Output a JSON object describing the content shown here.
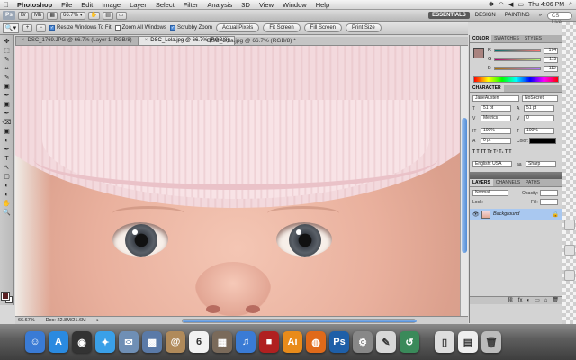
{
  "menubar": {
    "apple": "",
    "items": [
      "Photoshop",
      "File",
      "Edit",
      "Image",
      "Layer",
      "Select",
      "Filter",
      "Analysis",
      "3D",
      "View",
      "Window",
      "Help"
    ],
    "clock": "Thu 4:06 PM"
  },
  "appbar": {
    "logo": "Ps",
    "zoom": "66.7",
    "workspaces": [
      "ESSENTIALS",
      "DESIGN",
      "PAINTING"
    ],
    "more": "»",
    "search_placeholder": "CS Live"
  },
  "options": {
    "resize_windows": "Resize Windows To Fit",
    "zoom_all": "Zoom All Windows",
    "scrubby": "Scrubby Zoom",
    "buttons": [
      "Actual Pixels",
      "Fit Screen",
      "Fill Screen",
      "Print Size"
    ]
  },
  "tools": [
    "▭",
    "✥",
    "⬚",
    "✎",
    "⌗",
    "⌫",
    "✒",
    "🖌",
    "▣",
    "◐",
    "T",
    "↖",
    "▢",
    "✋",
    "🔍",
    "⬛"
  ],
  "doc": {
    "title": "DSC_Lola.jpg @ 66.7% (RGB/8) *",
    "tabs": [
      {
        "label": "DSC_1769.JPG @ 66.7% (Layer 1, RGB/8)",
        "active": false
      },
      {
        "label": "DSC_Lola.jpg @ 66.7% (RGB/8)",
        "active": true
      }
    ],
    "close": "×"
  },
  "status": {
    "zoom": "66.67%",
    "doc": "Doc: 22.8M/21.6M"
  },
  "color_panel": {
    "tabs": [
      "COLOR",
      "SWATCHES",
      "STYLES"
    ],
    "channels": [
      {
        "label": "R",
        "value": "174"
      },
      {
        "label": "G",
        "value": "115"
      },
      {
        "label": "B",
        "value": "113"
      }
    ]
  },
  "character": {
    "tab": "CHARACTER",
    "font": "JaneAusten",
    "style": "NoSecret",
    "size": "51 pt",
    "leading": "51 pt",
    "kerning": "Metrics",
    "tracking": "0",
    "vscale": "100%",
    "hscale": "100%",
    "baseline": "0 pt",
    "color_label": "Color:",
    "language": "English: USA",
    "aa": "Sharp",
    "aa_label": "aa"
  },
  "layers": {
    "tabs": [
      "LAYERS",
      "CHANNELS",
      "PATHS"
    ],
    "blend": "Normal",
    "opacity_label": "Opacity:",
    "lock_label": "Lock:",
    "fill_label": "Fill:",
    "row_name": "Background",
    "footer_icons": [
      "⛓",
      "fx",
      "◐",
      "▭",
      "⌂",
      "🗑"
    ]
  },
  "dock": {
    "icons": [
      {
        "name": "finder",
        "glyph": "☺",
        "color": "#3a7bd5"
      },
      {
        "name": "app-store",
        "glyph": "A",
        "color": "#2a8ae0"
      },
      {
        "name": "dashboard",
        "glyph": "◉",
        "color": "#333"
      },
      {
        "name": "safari",
        "glyph": "✦",
        "color": "#3aa0e8"
      },
      {
        "name": "mail",
        "glyph": "✉",
        "color": "#6f8fb5"
      },
      {
        "name": "iphoto",
        "glyph": "▩",
        "color": "#5a7aa8"
      },
      {
        "name": "address-book",
        "glyph": "@",
        "color": "#b08a5a"
      },
      {
        "name": "ical",
        "glyph": "6",
        "color": "#f2f2f2"
      },
      {
        "name": "preview",
        "glyph": "▦",
        "color": "#7a6a5a"
      },
      {
        "name": "itunes",
        "glyph": "♫",
        "color": "#3a7bd5"
      },
      {
        "name": "photo-booth",
        "glyph": "■",
        "color": "#b02020"
      },
      {
        "name": "illustrator",
        "glyph": "Ai",
        "color": "#e98b1a"
      },
      {
        "name": "firefox",
        "glyph": "◍",
        "color": "#e06a1a"
      },
      {
        "name": "photoshop",
        "glyph": "Ps",
        "color": "#1e5fa8"
      },
      {
        "name": "system-preferences",
        "glyph": "⚙",
        "color": "#888"
      },
      {
        "name": "textedit",
        "glyph": "✎",
        "color": "#d8d8d8"
      },
      {
        "name": "time-machine",
        "glyph": "↺",
        "color": "#3a8a5a"
      }
    ],
    "right_icons": [
      {
        "name": "documents-stack",
        "glyph": "▯",
        "color": "#ddd"
      },
      {
        "name": "downloads-stack",
        "glyph": "▤",
        "color": "#eee"
      },
      {
        "name": "trash",
        "glyph": "🗑",
        "color": "#bbb"
      }
    ]
  },
  "colors": {
    "foreground": "#a9837f",
    "selection": "#a9c8f0",
    "accent": "#4f8bd6"
  }
}
